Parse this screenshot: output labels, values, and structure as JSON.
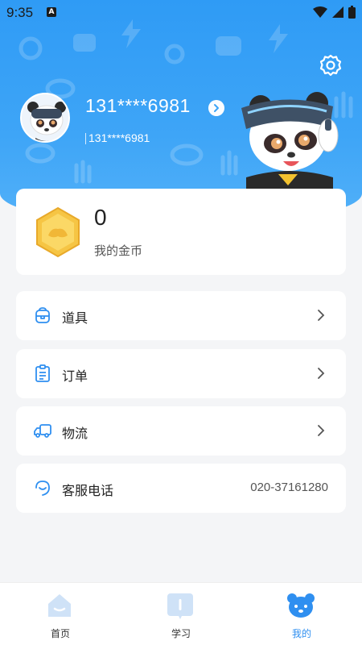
{
  "status_bar": {
    "time": "9:35",
    "notif_badge": "A"
  },
  "profile": {
    "display_name": "131****6981",
    "account_id": "131****6981"
  },
  "coins": {
    "value": "0",
    "label": "我的金币"
  },
  "menu": [
    {
      "label": "道具",
      "icon": "backpack-icon"
    },
    {
      "label": "订单",
      "icon": "clipboard-icon"
    },
    {
      "label": "物流",
      "icon": "truck-icon"
    }
  ],
  "service": {
    "label": "客服电话",
    "phone": "020-37161280",
    "icon": "headset-icon"
  },
  "tabs": [
    {
      "label": "首页",
      "icon": "home-icon"
    },
    {
      "label": "学习",
      "icon": "book-icon"
    },
    {
      "label": "我的",
      "icon": "bear-icon"
    }
  ],
  "colors": {
    "brand": "#2f9bf5",
    "active_tab": "#2f8ff0",
    "coin": "#f6c544"
  }
}
